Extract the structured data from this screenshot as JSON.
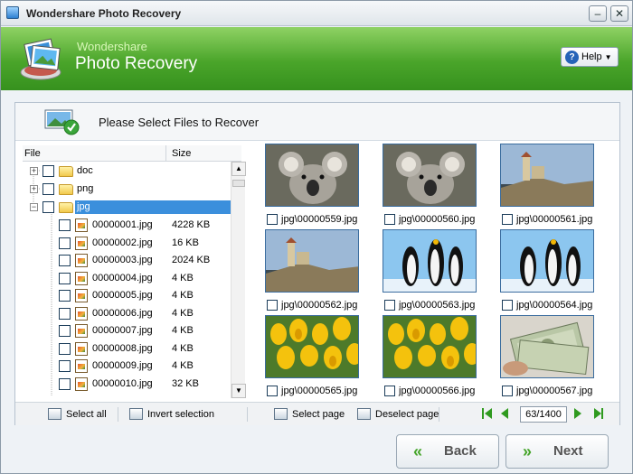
{
  "window": {
    "title": "Wondershare Photo Recovery",
    "minimize_glyph": "–",
    "close_glyph": "✕"
  },
  "banner": {
    "brand": "Wondershare",
    "product": "Photo Recovery",
    "help_label": "Help",
    "help_icon": "question-icon"
  },
  "panel": {
    "title": "Please Select Files to Recover"
  },
  "tree": {
    "columns": {
      "file": "File",
      "size": "Size"
    },
    "folders": [
      {
        "name": "doc",
        "expanded": false
      },
      {
        "name": "png",
        "expanded": false
      },
      {
        "name": "jpg",
        "expanded": true
      }
    ],
    "files": [
      {
        "name": "00000001.jpg",
        "size": "4228 KB"
      },
      {
        "name": "00000002.jpg",
        "size": "16 KB"
      },
      {
        "name": "00000003.jpg",
        "size": "2024 KB"
      },
      {
        "name": "00000004.jpg",
        "size": "4 KB"
      },
      {
        "name": "00000005.jpg",
        "size": "4 KB"
      },
      {
        "name": "00000006.jpg",
        "size": "4 KB"
      },
      {
        "name": "00000007.jpg",
        "size": "4 KB"
      },
      {
        "name": "00000008.jpg",
        "size": "4 KB"
      },
      {
        "name": "00000009.jpg",
        "size": "4 KB"
      },
      {
        "name": "00000010.jpg",
        "size": "32 KB"
      }
    ]
  },
  "thumbnails": [
    {
      "label": "jpg\\00000559.jpg",
      "picture": "koala"
    },
    {
      "label": "jpg\\00000560.jpg",
      "picture": "koala"
    },
    {
      "label": "jpg\\00000561.jpg",
      "picture": "lighthouse"
    },
    {
      "label": "jpg\\00000562.jpg",
      "picture": "lighthouse"
    },
    {
      "label": "jpg\\00000563.jpg",
      "picture": "penguins"
    },
    {
      "label": "jpg\\00000564.jpg",
      "picture": "penguins"
    },
    {
      "label": "jpg\\00000565.jpg",
      "picture": "tulips"
    },
    {
      "label": "jpg\\00000566.jpg",
      "picture": "tulips"
    },
    {
      "label": "jpg\\00000567.jpg",
      "picture": "money"
    }
  ],
  "toolbar": {
    "select_all": "Select all",
    "invert_selection": "Invert selection",
    "select_page": "Select page",
    "deselect_page": "Deselect page",
    "page_indicator": "63/1400"
  },
  "footer": {
    "back_label": "Back",
    "next_label": "Next"
  },
  "colors": {
    "banner_green": "#4aa52a",
    "selection_blue": "#3b8fdc",
    "nav_green": "#2f9a1f"
  }
}
